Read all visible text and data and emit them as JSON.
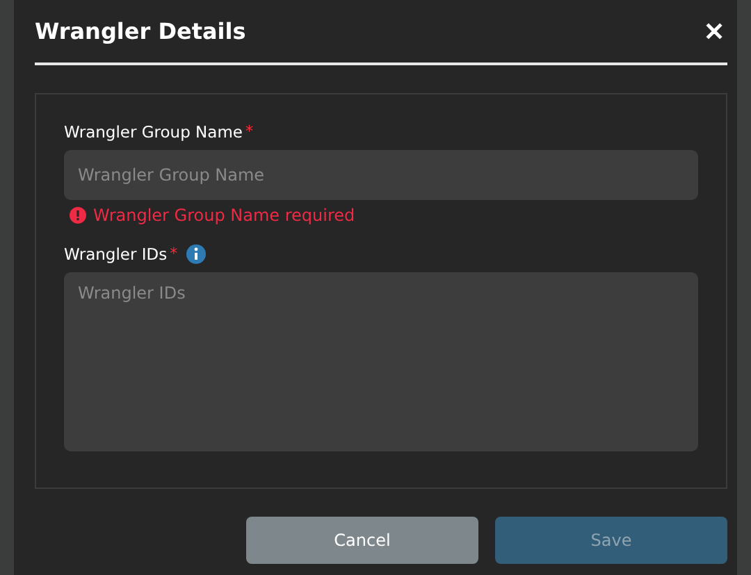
{
  "dialog": {
    "title": "Wrangler Details",
    "close": "✕"
  },
  "fields": [
    {
      "kind": "input",
      "label": "Wrangler Group Name",
      "required_mark": "*",
      "placeholder": "Wrangler Group Name",
      "info": false,
      "error": "Wrangler Group Name required"
    },
    {
      "kind": "textarea",
      "label": "Wrangler IDs",
      "required_mark": "*",
      "placeholder": "Wrangler IDs",
      "info": true
    }
  ],
  "buttons": [
    {
      "label": "Cancel",
      "kind": "secondary",
      "disabled": false
    },
    {
      "label": "Save",
      "kind": "primary",
      "disabled": true
    }
  ]
}
